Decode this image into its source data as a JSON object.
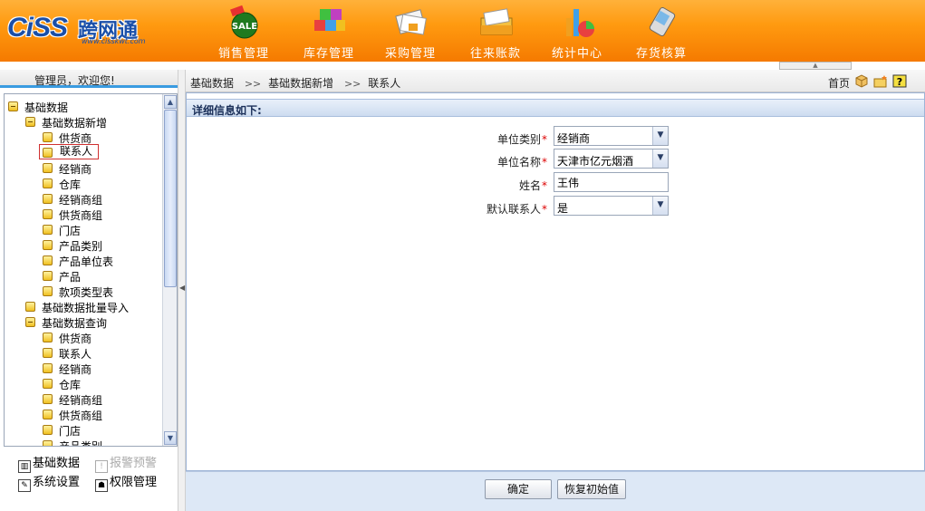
{
  "brand": {
    "logo_text": "CiSS",
    "logo_cn": "跨网通",
    "logo_url": "www.cisskwt.com"
  },
  "top_nav": [
    {
      "label": "销售管理",
      "icon": "sale-icon"
    },
    {
      "label": "库存管理",
      "icon": "inventory-cubes-icon"
    },
    {
      "label": "采购管理",
      "icon": "purchase-docs-icon"
    },
    {
      "label": "往来账款",
      "icon": "accounts-folder-icon"
    },
    {
      "label": "统计中心",
      "icon": "statistics-chart-icon"
    },
    {
      "label": "存货核算",
      "icon": "pda-icon"
    }
  ],
  "welcome": "管理员，欢迎您!",
  "tree": [
    {
      "label": "基础数据",
      "level": 0,
      "expanded": true
    },
    {
      "label": "基础数据新增",
      "level": 1,
      "expanded": true
    },
    {
      "label": "供货商",
      "level": 2
    },
    {
      "label": "联系人",
      "level": 2,
      "selected": true
    },
    {
      "label": "经销商",
      "level": 2
    },
    {
      "label": "仓库",
      "level": 2
    },
    {
      "label": "经销商组",
      "level": 2
    },
    {
      "label": "供货商组",
      "level": 2
    },
    {
      "label": "门店",
      "level": 2
    },
    {
      "label": "产品类别",
      "level": 2
    },
    {
      "label": "产品单位表",
      "level": 2
    },
    {
      "label": "产品",
      "level": 2
    },
    {
      "label": "款项类型表",
      "level": 2
    },
    {
      "label": "基础数据批量导入",
      "level": 1
    },
    {
      "label": "基础数据查询",
      "level": 1,
      "expanded": true
    },
    {
      "label": "供货商",
      "level": 2
    },
    {
      "label": "联系人",
      "level": 2
    },
    {
      "label": "经销商",
      "level": 2
    },
    {
      "label": "仓库",
      "level": 2
    },
    {
      "label": "经销商组",
      "level": 2
    },
    {
      "label": "供货商组",
      "level": 2
    },
    {
      "label": "门店",
      "level": 2
    },
    {
      "label": "产品类别",
      "level": 2
    }
  ],
  "bottom_menu": {
    "basic_data": "基础数据",
    "alert": "报警预警",
    "system_settings": "系统设置",
    "permissions": "权限管理"
  },
  "breadcrumb": [
    "基础数据",
    "基础数据新增",
    "联系人"
  ],
  "breadcrumb_sep": ">>",
  "home_label": "首页",
  "panel_title": "详细信息如下:",
  "form": {
    "unit_type": {
      "label": "单位类别",
      "value": "经销商"
    },
    "unit_name": {
      "label": "单位名称",
      "value": "天津市亿元烟酒"
    },
    "name": {
      "label": "姓名",
      "value": "王伟"
    },
    "default_contact": {
      "label": "默认联系人",
      "value": "是"
    },
    "required_mark": "*"
  },
  "buttons": {
    "confirm": "确定",
    "reset": "恢复初始值"
  },
  "colors": {
    "header_orange": "#f57a00",
    "accent_blue": "#3a9be0",
    "panel_head": "#cddcf0",
    "required_red": "#dd0000"
  }
}
